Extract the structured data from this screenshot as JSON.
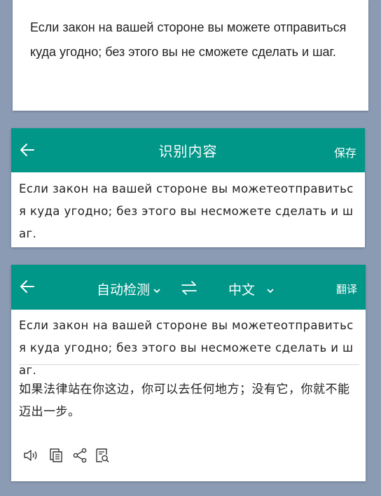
{
  "source_card": {
    "text": "Если закон на вашей стороне вы можете отправиться куда угодно; без этого вы не сможете сделать и шаг."
  },
  "recognize_card": {
    "title": "识别内容",
    "save_label": "保存",
    "text": "Если закон на вашей стороне вы можетеотправиться куда угодно; без этого вы несможете сделать и шаг."
  },
  "translate_card": {
    "source_lang": "自动检测",
    "target_lang": "中文",
    "translate_label": "翻译",
    "source_text": "Если закон на вашей стороне вы можетеотправиться куда угодно; без этого вы несможете сделать и шаг.",
    "translated_text": "如果法律站在你这边，你可以去任何地方；没有它，你就不能迈出一步。",
    "tools": [
      "speaker-icon",
      "copy-icon",
      "share-icon",
      "search-document-icon"
    ]
  },
  "colors": {
    "accent": "#009688",
    "background": "#8a9bb3"
  }
}
